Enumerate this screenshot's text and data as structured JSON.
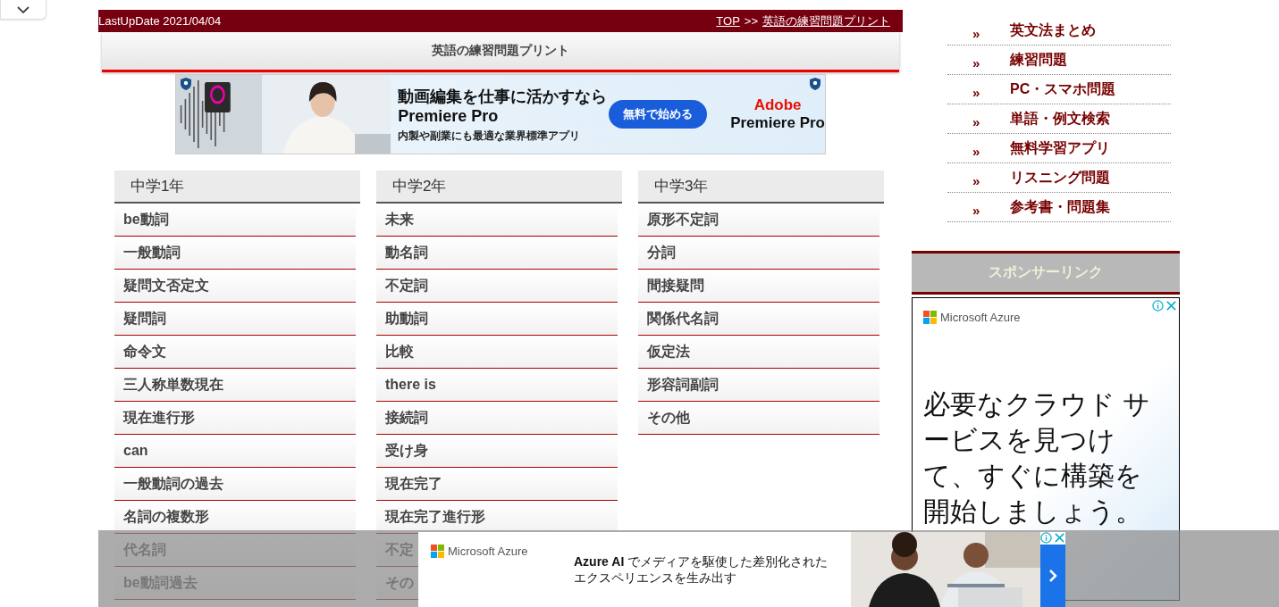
{
  "header": {
    "last_update": "LastUpDate 2021/04/04",
    "breadcrumbs": [
      {
        "label": "TOP"
      },
      {
        "label": "英語の練習問題プリント"
      }
    ],
    "separator": ">>"
  },
  "page_title": "英語の練習問題プリント",
  "banner_ad": {
    "headline": "動画編集を仕事に活かすなら",
    "product": "Premiere Pro",
    "subline": "内製や副業にも最適な業界標準アプリ",
    "button": "無料で始める",
    "brand": "Adobe",
    "brand_product": "Premiere Pro"
  },
  "columns": [
    {
      "title": "中学1年",
      "items": [
        "be動詞",
        "一般動詞",
        "疑問文否定文",
        "疑問詞",
        "命令文",
        "三人称単数現在",
        "現在進行形",
        "can",
        "一般動詞の過去",
        "名詞の複数形",
        "代名詞",
        "be動詞過去"
      ]
    },
    {
      "title": "中学2年",
      "items": [
        "未来",
        "動名詞",
        "不定詞",
        "助動詞",
        "比較",
        "there is",
        "接続詞",
        "受け身",
        "現在完了",
        "現在完了進行形",
        "不定",
        "その"
      ]
    },
    {
      "title": "中学3年",
      "items": [
        "原形不定詞",
        "分詞",
        "間接疑問",
        "関係代名詞",
        "仮定法",
        "形容詞副詞",
        "その他"
      ]
    }
  ],
  "sidebar": {
    "links": [
      {
        "marker": "»",
        "label": "英文法まとめ"
      },
      {
        "marker": "»",
        "label": "練習問題"
      },
      {
        "marker": "»",
        "label": "PC・スマホ問題"
      },
      {
        "marker": "»",
        "label": "単語・例文検索"
      },
      {
        "marker": "»",
        "label": "無料学習アプリ"
      },
      {
        "marker": "»",
        "label": "リスニング問題"
      },
      {
        "marker": "»",
        "label": "参考書・問題集"
      }
    ],
    "sponsor_heading": "スポンサーリンク",
    "ad": {
      "brand": "Microsoft Azure",
      "message": "必要なクラウド サービスを見つけて、すぐに構築を開始しましょう。"
    }
  },
  "bottom_ad": {
    "brand": "Microsoft Azure",
    "message": "**Azure AI** でメディアを駆使した差別化されたエクスペリエンスを生み出す"
  }
}
